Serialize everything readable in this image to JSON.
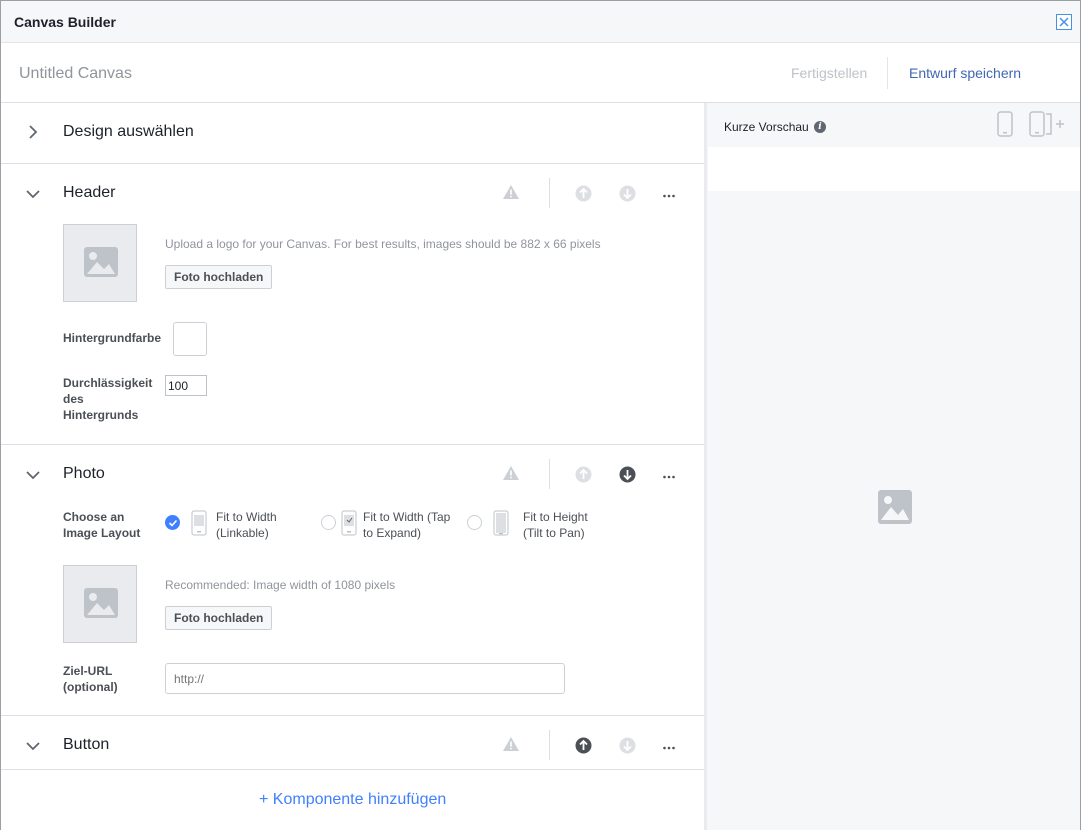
{
  "window": {
    "title": "Canvas Builder",
    "close_icon": "close-icon"
  },
  "topbar": {
    "canvas_name": "Untitled Canvas",
    "finish_label": "Fertigstellen",
    "save_draft_label": "Entwurf speichern"
  },
  "sections": {
    "design": {
      "title": "Design auswählen"
    },
    "header": {
      "title": "Header",
      "upload_hint": "Upload a logo for your Canvas. For best results, images should be 882 x 66 pixels",
      "upload_label": "Foto hochladen",
      "bg_color_label": "Hintergrundfarbe",
      "opacity_label_1": "Durchlässigkeit",
      "opacity_label_2": "des",
      "opacity_label_3": "Hintergrunds",
      "opacity_value": "100"
    },
    "photo": {
      "title": "Photo",
      "layout_label_1": "Choose an",
      "layout_label_2": "Image Layout",
      "layouts": [
        {
          "line1": "Fit to Width",
          "line2": "(Linkable)",
          "selected": true
        },
        {
          "line1": "Fit to Width (Tap",
          "line2": "to Expand)",
          "selected": false
        },
        {
          "line1": "Fit to Height",
          "line2": "(Tilt to Pan)",
          "selected": false
        }
      ],
      "upload_hint": "Recommended: Image width of 1080 pixels",
      "upload_label": "Foto hochladen",
      "url_label_1": "Ziel-URL",
      "url_label_2": "(optional)",
      "url_placeholder": "http://"
    },
    "button": {
      "title": "Button"
    }
  },
  "add_component_label": "+ Komponente hinzufügen",
  "preview": {
    "label": "Kurze Vorschau",
    "info_glyph": "i"
  },
  "colors": {
    "accent": "#4080ff",
    "link": "#4267b2",
    "muted": "#90949c",
    "panel_bg": "#f6f7f9"
  }
}
